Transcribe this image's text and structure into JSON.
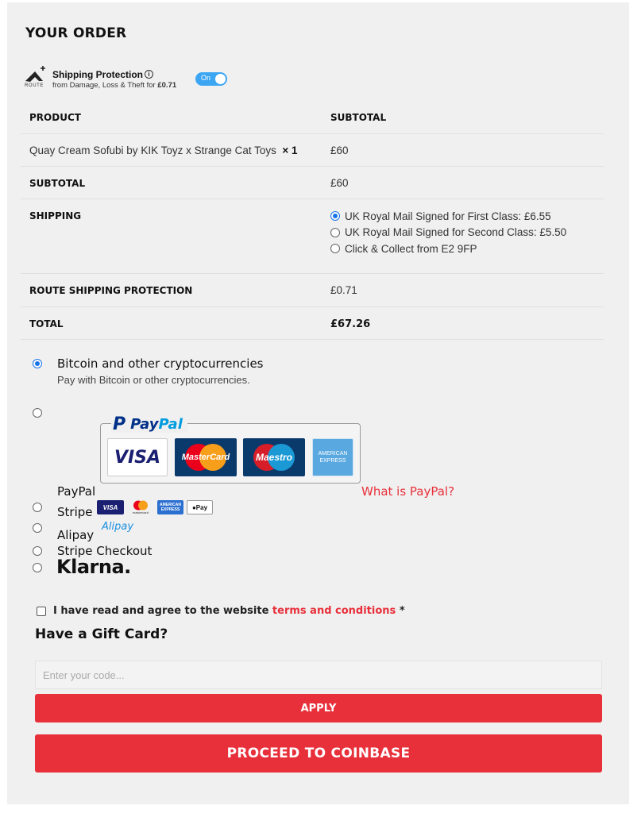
{
  "order": {
    "title": "YOUR ORDER"
  },
  "route": {
    "logo_text": "ROUTE",
    "title": "Shipping Protection",
    "info_icon": "info-icon",
    "subtitle_prefix": "from Damage, Loss & Theft for",
    "price": "£0.71",
    "toggle_label": "On",
    "toggle_on": true
  },
  "table": {
    "headers": {
      "product": "PRODUCT",
      "subtotal": "SUBTOTAL"
    },
    "item": {
      "name": "Quay Cream Sofubi by KIK Toyz x Strange Cat Toys",
      "qty": "× 1",
      "price": "£60"
    },
    "subtotal": {
      "label": "SUBTOTAL",
      "value": "£60"
    },
    "shipping": {
      "label": "SHIPPING",
      "options": [
        {
          "label": "UK Royal Mail Signed for First Class: £6.55",
          "selected": true
        },
        {
          "label": "UK Royal Mail Signed for Second Class: £5.50",
          "selected": false
        },
        {
          "label": "Click & Collect from E2 9FP",
          "selected": false
        }
      ]
    },
    "route": {
      "label": "ROUTE SHIPPING PROTECTION",
      "value": "£0.71"
    },
    "total": {
      "label": "TOTAL",
      "value": "£67.26"
    }
  },
  "payment": {
    "crypto": {
      "title": "Bitcoin and other cryptocurrencies",
      "desc": "Pay with Bitcoin or other cryptocurrencies.",
      "selected": true
    },
    "paypal": {
      "logo_p": "P",
      "logo_word_a": "Pay",
      "logo_word_b": "Pal",
      "cards": [
        "VISA",
        "MasterCard",
        "Maestro",
        "AMERICAN EXPRESS"
      ],
      "title": "PayPal",
      "link": "What is PayPal?"
    },
    "stripe": {
      "title": "Stripe",
      "badges": [
        "VISA",
        "mastercard",
        "AMERICAN EXPRESS",
        "Pay"
      ]
    },
    "alipay": {
      "title": "Alipay",
      "logo": "Alipay"
    },
    "stripe_checkout": {
      "title": "Stripe Checkout"
    },
    "klarna": {
      "logo": "Klarna."
    }
  },
  "terms": {
    "prefix": "I have read and agree to the website",
    "link": "terms and conditions",
    "required": "*"
  },
  "gift": {
    "title": "Have a Gift Card?",
    "placeholder": "Enter your code...",
    "apply_label": "APPLY"
  },
  "proceed_label": "PROCEED TO COINBASE",
  "colors": {
    "accent": "#e8303b",
    "radio": "#1a73e8",
    "toggle": "#3da6f2",
    "paypal_dark": "#003087",
    "paypal_light": "#009cde"
  }
}
